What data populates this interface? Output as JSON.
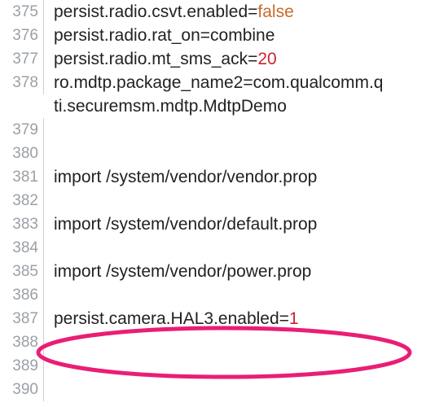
{
  "lines": [
    {
      "num": "375",
      "segments": [
        {
          "t": "persist.radio.csvt.enabled=",
          "c": ""
        },
        {
          "t": "false",
          "c": "kw-false"
        }
      ]
    },
    {
      "num": "376",
      "segments": [
        {
          "t": "persist.radio.rat_on=combine",
          "c": ""
        }
      ]
    },
    {
      "num": "377",
      "segments": [
        {
          "t": "persist.radio.mt_sms_ack=",
          "c": ""
        },
        {
          "t": "20",
          "c": "kw-num"
        }
      ]
    },
    {
      "num": "378",
      "segments": [
        {
          "t": "ro.mdtp.package_name2=com.qualcomm.q",
          "c": ""
        }
      ]
    },
    {
      "num": "",
      "segments": [
        {
          "t": "ti.securemsm.mdtp.MdtpDemo",
          "c": ""
        }
      ],
      "wrap": true
    },
    {
      "num": "379",
      "segments": []
    },
    {
      "num": "380",
      "segments": []
    },
    {
      "num": "381",
      "segments": [
        {
          "t": "import /system/vendor/vendor.prop",
          "c": ""
        }
      ]
    },
    {
      "num": "382",
      "segments": []
    },
    {
      "num": "383",
      "segments": [
        {
          "t": "import /system/vendor/default.prop",
          "c": ""
        }
      ]
    },
    {
      "num": "384",
      "segments": []
    },
    {
      "num": "385",
      "segments": [
        {
          "t": "import /system/vendor/power.prop",
          "c": ""
        }
      ]
    },
    {
      "num": "386",
      "segments": []
    },
    {
      "num": "387",
      "segments": [
        {
          "t": "persist.camera.HAL3.enabled=",
          "c": ""
        },
        {
          "t": "1",
          "c": "kw-num"
        }
      ]
    },
    {
      "num": "388",
      "segments": []
    },
    {
      "num": "389",
      "segments": []
    },
    {
      "num": "390",
      "segments": []
    }
  ],
  "highlight": {
    "color": "#e91e75",
    "strokeWidth": 5
  }
}
